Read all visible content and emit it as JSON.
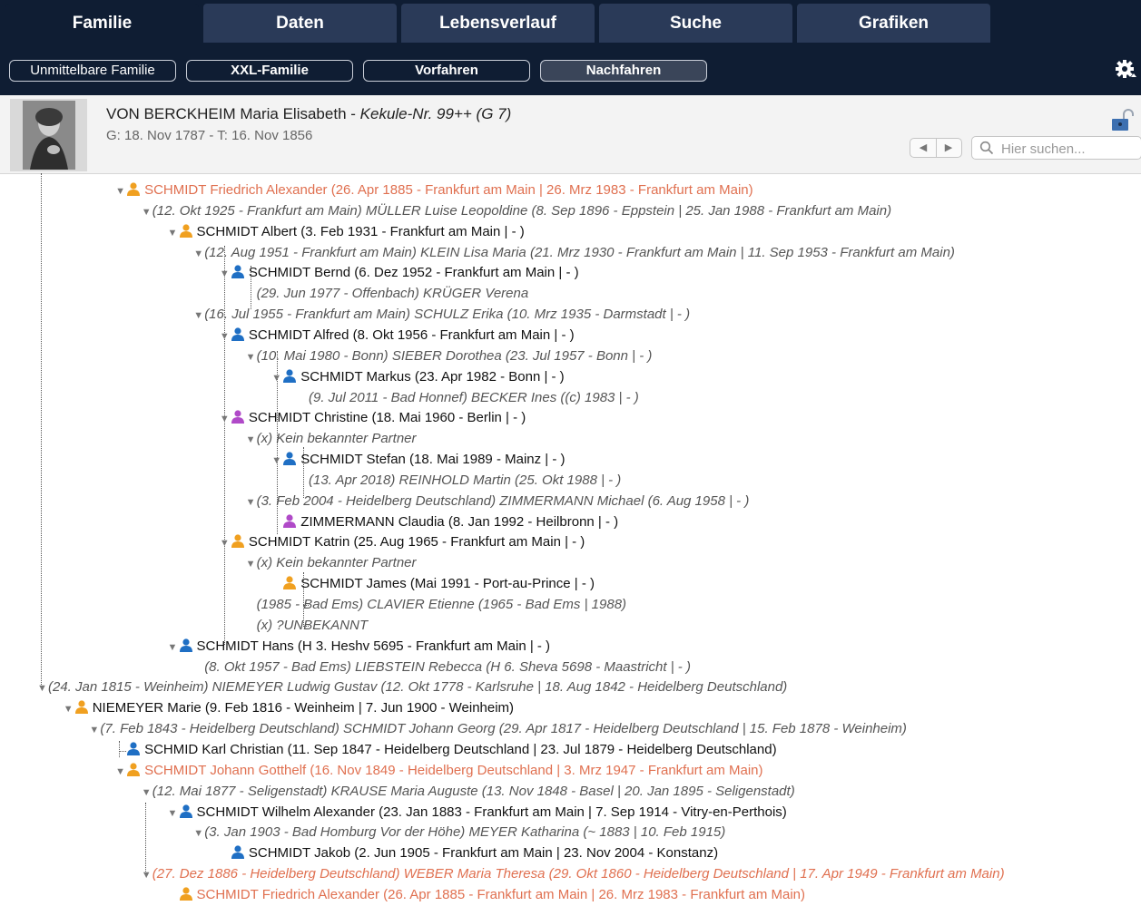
{
  "tabs": [
    "Familie",
    "Daten",
    "Lebensverlauf",
    "Suche",
    "Grafiken"
  ],
  "active_tab": 0,
  "subtabs": [
    "Unmittelbare Familie",
    "XXL-Familie",
    "Vorfahren",
    "Nachfahren"
  ],
  "active_subtab": 3,
  "icons": {
    "settings": "gear-icon",
    "lock": "lock-icon",
    "search": "magnifier-icon",
    "prev": "triangle-left-icon",
    "next": "triangle-right-icon"
  },
  "colors": {
    "topbar": "#0f1d33",
    "tab": "#2a3a58",
    "selected_text": "#e07050",
    "male": "#1f6fc4",
    "female": "#b04ac8",
    "unknown": "#f0a020"
  },
  "person": {
    "name": "VON BERCKHEIM Maria Elisabeth",
    "kekule": "Kekule-Nr.  99++ (G 7)",
    "dates": "G: 18. Nov 1787 - T: 16. Nov 1856"
  },
  "search": {
    "placeholder": "Hier suchen..."
  },
  "tree": [
    {
      "kind": "person",
      "level": 4,
      "tri": true,
      "icon": "unknown",
      "selected": true,
      "text": "SCHMIDT Friedrich Alexander (26. Apr 1885 - Frankfurt am Main | 26. Mrz 1983 - Frankfurt am Main)"
    },
    {
      "kind": "partner",
      "level": 5,
      "tri": true,
      "text": "(12. Okt 1925 - Frankfurt am Main) MÜLLER Luise Leopoldine (8. Sep 1896 - Eppstein | 25. Jan 1988 - Frankfurt am Main)"
    },
    {
      "kind": "person",
      "level": 6,
      "tri": true,
      "icon": "unknown",
      "text": "SCHMIDT Albert (3. Feb 1931 - Frankfurt am Main |  - )"
    },
    {
      "kind": "partner",
      "level": 7,
      "tri": true,
      "text": "(12. Aug 1951 - Frankfurt am Main) KLEIN Lisa Maria (21. Mrz 1930 - Frankfurt am Main | 11. Sep 1953 - Frankfurt am Main)"
    },
    {
      "kind": "person",
      "level": 8,
      "tri": true,
      "icon": "male",
      "text": "SCHMIDT Bernd (6. Dez 1952 - Frankfurt am Main |  - )"
    },
    {
      "kind": "partner",
      "level": 9,
      "tri": false,
      "text": "(29. Jun 1977 - Offenbach) KRÜGER Verena"
    },
    {
      "kind": "partner",
      "level": 7,
      "tri": true,
      "text": "(16. Jul 1955 - Frankfurt am Main) SCHULZ Erika (10. Mrz 1935 - Darmstadt |  - )"
    },
    {
      "kind": "person",
      "level": 8,
      "tri": true,
      "icon": "male",
      "text": "SCHMIDT Alfred (8. Okt 1956 - Frankfurt am Main |  - )"
    },
    {
      "kind": "partner",
      "level": 9,
      "tri": true,
      "text": "(10. Mai 1980 - Bonn) SIEBER Dorothea (23. Jul 1957 - Bonn |  - )"
    },
    {
      "kind": "person",
      "level": 10,
      "tri": true,
      "icon": "male",
      "text": "SCHMIDT Markus (23. Apr 1982 - Bonn |  - )"
    },
    {
      "kind": "partner",
      "level": 11,
      "tri": false,
      "text": "(9. Jul 2011 - Bad Honnef) BECKER Ines ((c) 1983 |  - )"
    },
    {
      "kind": "person",
      "level": 8,
      "tri": true,
      "icon": "female",
      "text": "SCHMIDT Christine (18. Mai 1960 - Berlin |  - )"
    },
    {
      "kind": "partner",
      "level": 9,
      "tri": true,
      "text": "(x) Kein bekannter Partner"
    },
    {
      "kind": "person",
      "level": 10,
      "tri": true,
      "icon": "male",
      "text": "SCHMIDT Stefan (18. Mai 1989 - Mainz |  - )"
    },
    {
      "kind": "partner",
      "level": 11,
      "tri": false,
      "text": "(13. Apr 2018) REINHOLD Martin (25. Okt 1988 |  - )"
    },
    {
      "kind": "partner",
      "level": 9,
      "tri": true,
      "text": "(3. Feb 2004 - Heidelberg Deutschland) ZIMMERMANN Michael (6. Aug 1958 |  - )"
    },
    {
      "kind": "person",
      "level": 10,
      "tri": false,
      "icon": "female",
      "text": "ZIMMERMANN Claudia (8. Jan 1992 - Heilbronn |  - )"
    },
    {
      "kind": "person",
      "level": 8,
      "tri": true,
      "icon": "unknown",
      "text": "SCHMIDT Katrin (25. Aug 1965 - Frankfurt am Main |  - )"
    },
    {
      "kind": "partner",
      "level": 9,
      "tri": true,
      "text": "(x) Kein bekannter Partner"
    },
    {
      "kind": "person",
      "level": 10,
      "tri": false,
      "icon": "unknown",
      "text": "SCHMIDT James (Mai 1991 - Port-au-Prince |  - )"
    },
    {
      "kind": "partner",
      "level": 9,
      "tri": false,
      "text": "(1985 - Bad Ems) CLAVIER Etienne (1965 - Bad Ems | 1988)"
    },
    {
      "kind": "partner",
      "level": 9,
      "tri": false,
      "text": "(x) ?UNBEKANNT"
    },
    {
      "kind": "person",
      "level": 6,
      "tri": true,
      "icon": "male",
      "text": "SCHMIDT Hans (H 3. Heshv 5695 - Frankfurt am Main |  - )"
    },
    {
      "kind": "partner",
      "level": 7,
      "tri": false,
      "text": "(8. Okt 1957 - Bad Ems) LIEBSTEIN Rebecca (H 6. Sheva 5698 - Maastricht |  - )"
    },
    {
      "kind": "partner",
      "level": 1,
      "tri": true,
      "text": "(24. Jan 1815 - Weinheim) NIEMEYER Ludwig Gustav (12. Okt 1778 - Karlsruhe | 18. Aug 1842 - Heidelberg Deutschland)"
    },
    {
      "kind": "person",
      "level": 2,
      "tri": true,
      "icon": "unknown",
      "text": "NIEMEYER Marie (9. Feb 1816 - Weinheim | 7. Jun 1900 - Weinheim)"
    },
    {
      "kind": "partner",
      "level": 3,
      "tri": true,
      "text": "(7. Feb 1843 - Heidelberg Deutschland) SCHMIDT Johann Georg (29. Apr 1817 - Heidelberg Deutschland | 15. Feb 1878 - Weinheim)"
    },
    {
      "kind": "person",
      "level": 4,
      "tri": false,
      "icon": "male",
      "text": "SCHMID Karl Christian (11. Sep 1847 - Heidelberg Deutschland | 23. Jul 1879 - Heidelberg Deutschland)"
    },
    {
      "kind": "person",
      "level": 4,
      "tri": true,
      "icon": "unknown",
      "selected": true,
      "text": "SCHMIDT Johann Gotthelf (16. Nov 1849 - Heidelberg Deutschland | 3. Mrz 1947 - Frankfurt am Main)"
    },
    {
      "kind": "partner",
      "level": 5,
      "tri": true,
      "text": "(12. Mai 1877 - Seligenstadt) KRAUSE Maria Auguste (13. Nov 1848 - Basel | 20. Jan 1895 - Seligenstadt)"
    },
    {
      "kind": "person",
      "level": 6,
      "tri": true,
      "icon": "male",
      "text": "SCHMIDT Wilhelm Alexander (23. Jan 1883 - Frankfurt am Main | 7. Sep 1914 - Vitry-en-Perthois)"
    },
    {
      "kind": "partner",
      "level": 7,
      "tri": true,
      "text": "(3. Jan 1903 - Bad Homburg Vor der Höhe) MEYER Katharina (~ 1883 | 10. Feb 1915)"
    },
    {
      "kind": "person",
      "level": 8,
      "tri": false,
      "icon": "male",
      "text": "SCHMIDT Jakob (2. Jun 1905 - Frankfurt am Main | 23. Nov 2004 - Konstanz)"
    },
    {
      "kind": "partner",
      "level": 5,
      "tri": true,
      "selected": true,
      "text": "(27. Dez 1886 - Heidelberg Deutschland) WEBER Maria Theresa (29. Okt 1860 - Heidelberg Deutschland | 17. Apr 1949 - Frankfurt am Main)"
    },
    {
      "kind": "person",
      "level": 6,
      "tri": false,
      "icon": "unknown",
      "selected": true,
      "text": "SCHMIDT Friedrich Alexander (26. Apr 1885 - Frankfurt am Main | 26. Mrz 1983 - Frankfurt am Main)"
    }
  ]
}
